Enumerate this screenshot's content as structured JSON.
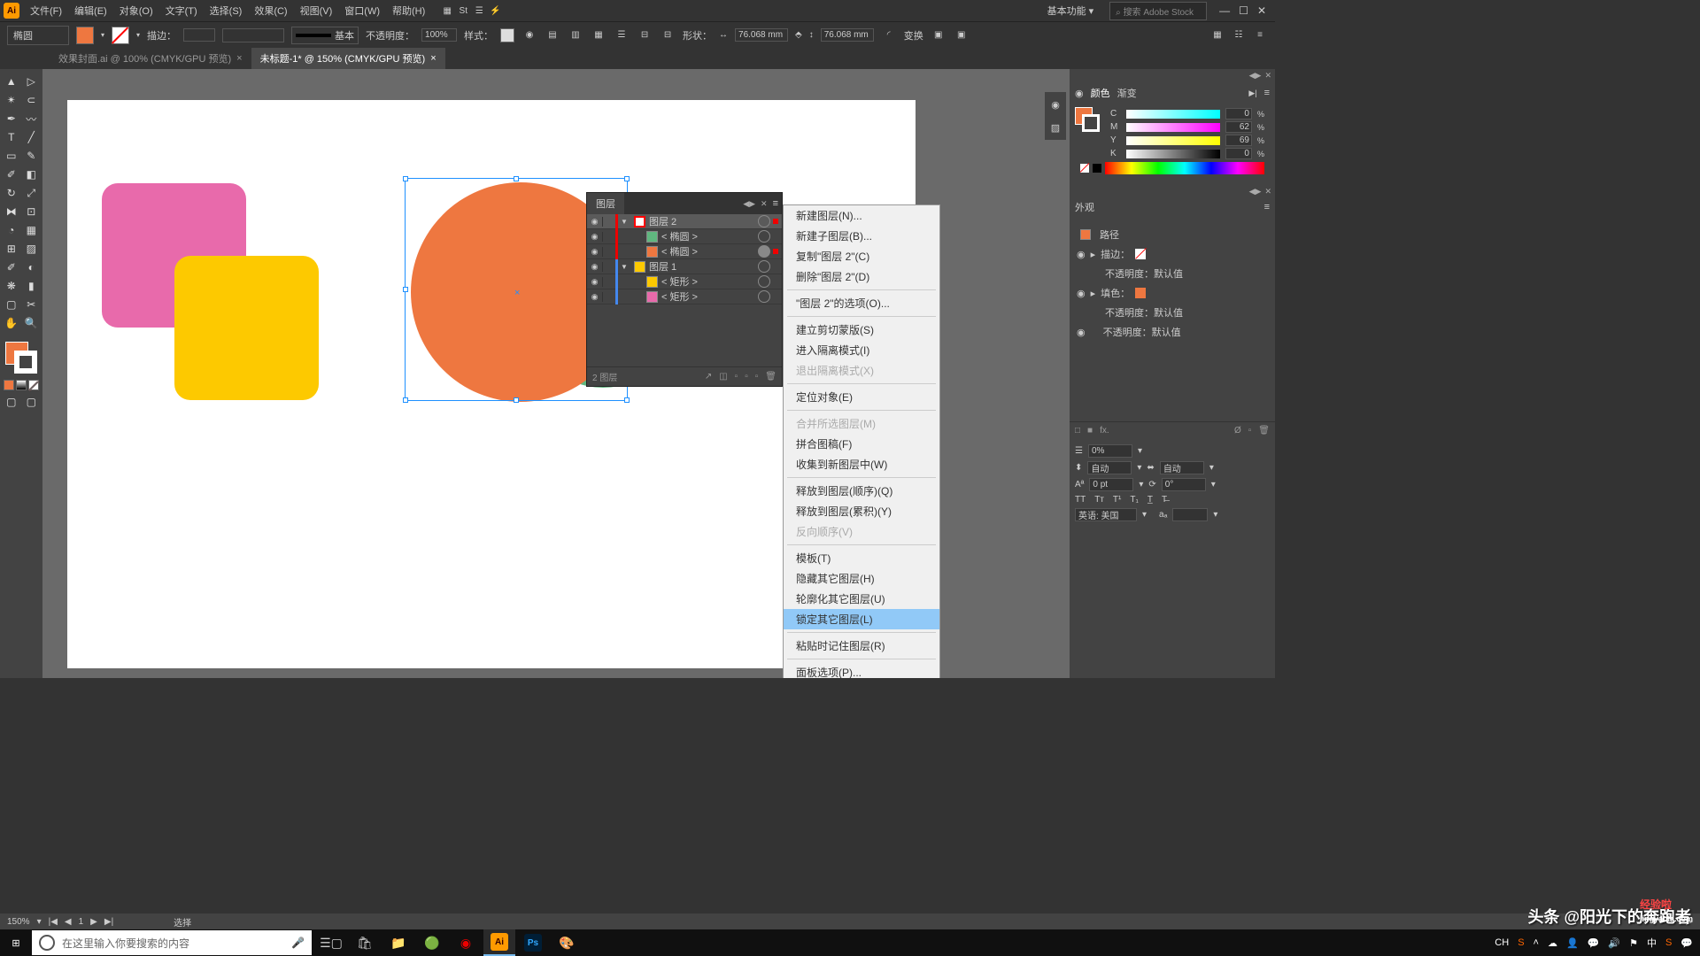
{
  "app": {
    "logo": "Ai"
  },
  "menu": {
    "file": "文件(F)",
    "edit": "编辑(E)",
    "object": "对象(O)",
    "text": "文字(T)",
    "select": "选择(S)",
    "effect": "效果(C)",
    "view": "视图(V)",
    "window": "窗口(W)",
    "help": "帮助(H)"
  },
  "titlebar": {
    "workspace": "基本功能",
    "stock_placeholder": "搜索 Adobe Stock"
  },
  "controlbar": {
    "shape": "椭圆",
    "stroke_label": "描边：",
    "basic": "基本",
    "opacity_label": "不透明度：",
    "opacity_val": "100%",
    "style_label": "样式：",
    "shape_label2": "形状：",
    "width": "76.068 mm",
    "height": "76.068 mm",
    "transform": "变换"
  },
  "tabs": {
    "t1": "效果封面.ai @ 100% (CMYK/GPU 预览)",
    "t2": "未标题-1* @ 150% (CMYK/GPU 预览)"
  },
  "layers": {
    "title": "图层",
    "layer2": "图层 2",
    "ellipse1": "< 椭圆 >",
    "ellipse2": "< 椭圆 >",
    "layer1": "图层 1",
    "rect1": "< 矩形 >",
    "rect2": "< 矩形 >",
    "count": "2 图层"
  },
  "context": {
    "new_layer": "新建图层(N)...",
    "new_sublayer": "新建子图层(B)...",
    "duplicate": "复制\"图层 2\"(C)",
    "delete": "删除\"图层 2\"(D)",
    "options": "\"图层 2\"的选项(O)...",
    "clipping": "建立剪切蒙版(S)",
    "isolation": "进入隔离模式(I)",
    "exit_isolation": "退出隔离模式(X)",
    "locate": "定位对象(E)",
    "merge": "合并所选图层(M)",
    "flatten": "拼合图稿(F)",
    "collect": "收集到新图层中(W)",
    "release_seq": "释放到图层(顺序)(Q)",
    "release_acc": "释放到图层(累积)(Y)",
    "reverse": "反向顺序(V)",
    "template": "模板(T)",
    "hide_others": "隐藏其它图层(H)",
    "outline_others": "轮廓化其它图层(U)",
    "lock_others": "锁定其它图层(L)",
    "paste_remember": "粘贴时记住图层(R)",
    "panel_options": "面板选项(P)..."
  },
  "color_panel": {
    "color_tab": "颜色",
    "gradient_tab": "渐变",
    "c": "0",
    "m": "62",
    "y": "69",
    "k": "0"
  },
  "appearance": {
    "title": "外观",
    "path": "路径",
    "stroke": "描边：",
    "opacity1": "不透明度：默认值",
    "fill": "填色：",
    "opacity2": "不透明度：默认值",
    "opacity3": "不透明度：默认值"
  },
  "char": {
    "kerning": "0%",
    "auto1": "自动",
    "auto2": "自动",
    "pt": "0 pt",
    "deg": "0°",
    "lang": "英语: 美国"
  },
  "status": {
    "zoom": "150%",
    "page": "1",
    "sel": "选择"
  },
  "taskbar": {
    "search_placeholder": "在这里输入你要搜索的内容",
    "ime": "中"
  },
  "watermark": {
    "text": "头条 @阳光下的奔跑者"
  }
}
